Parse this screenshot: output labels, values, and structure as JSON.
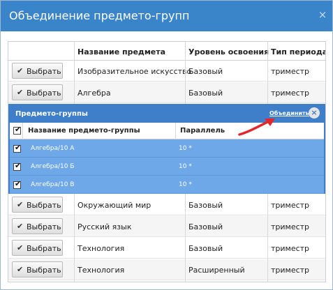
{
  "dialog": {
    "title": "Объединение предмето-групп",
    "close_glyph": "×"
  },
  "grid": {
    "columns": [
      "",
      "Название предмета",
      "Уровень освоения",
      "Тип периода"
    ],
    "select_label": "Выбрать",
    "check_glyph": "✔",
    "rows_top": [
      {
        "subject": "Изобразительное искусство",
        "level": "Базовый",
        "period": "триместр"
      },
      {
        "subject": "Алгебра",
        "level": "Базовый",
        "period": "триместр"
      }
    ],
    "rows_bottom": [
      {
        "subject": "Окружающий мир",
        "level": "Базовый",
        "period": "триместр"
      },
      {
        "subject": "Русский язык",
        "level": "Базовый",
        "period": "триместр"
      },
      {
        "subject": "Технология",
        "level": "Базовый",
        "period": "триместр"
      },
      {
        "subject": "Технология",
        "level": "Расширенный",
        "period": "триместр"
      }
    ]
  },
  "subpanel": {
    "title": "Предмето-группы",
    "merge_label": "Объединить",
    "close_glyph": "×",
    "columns": [
      "Название предмето-группы",
      "Параллель"
    ],
    "check_glyph": "✔",
    "rows": [
      {
        "name": "Алгебра/10 А",
        "parallel": "10 *",
        "checked": true
      },
      {
        "name": "Алгебра/10 Б",
        "parallel": "10 *",
        "checked": true
      },
      {
        "name": "Алгебра/10 В",
        "parallel": "10 *",
        "checked": true
      }
    ]
  },
  "colors": {
    "titlebar": "#3a85c9",
    "subpanel_header": "#3f7fc9",
    "selected_row": "#6ea8e8",
    "annotation_arrow": "#e3262b"
  }
}
